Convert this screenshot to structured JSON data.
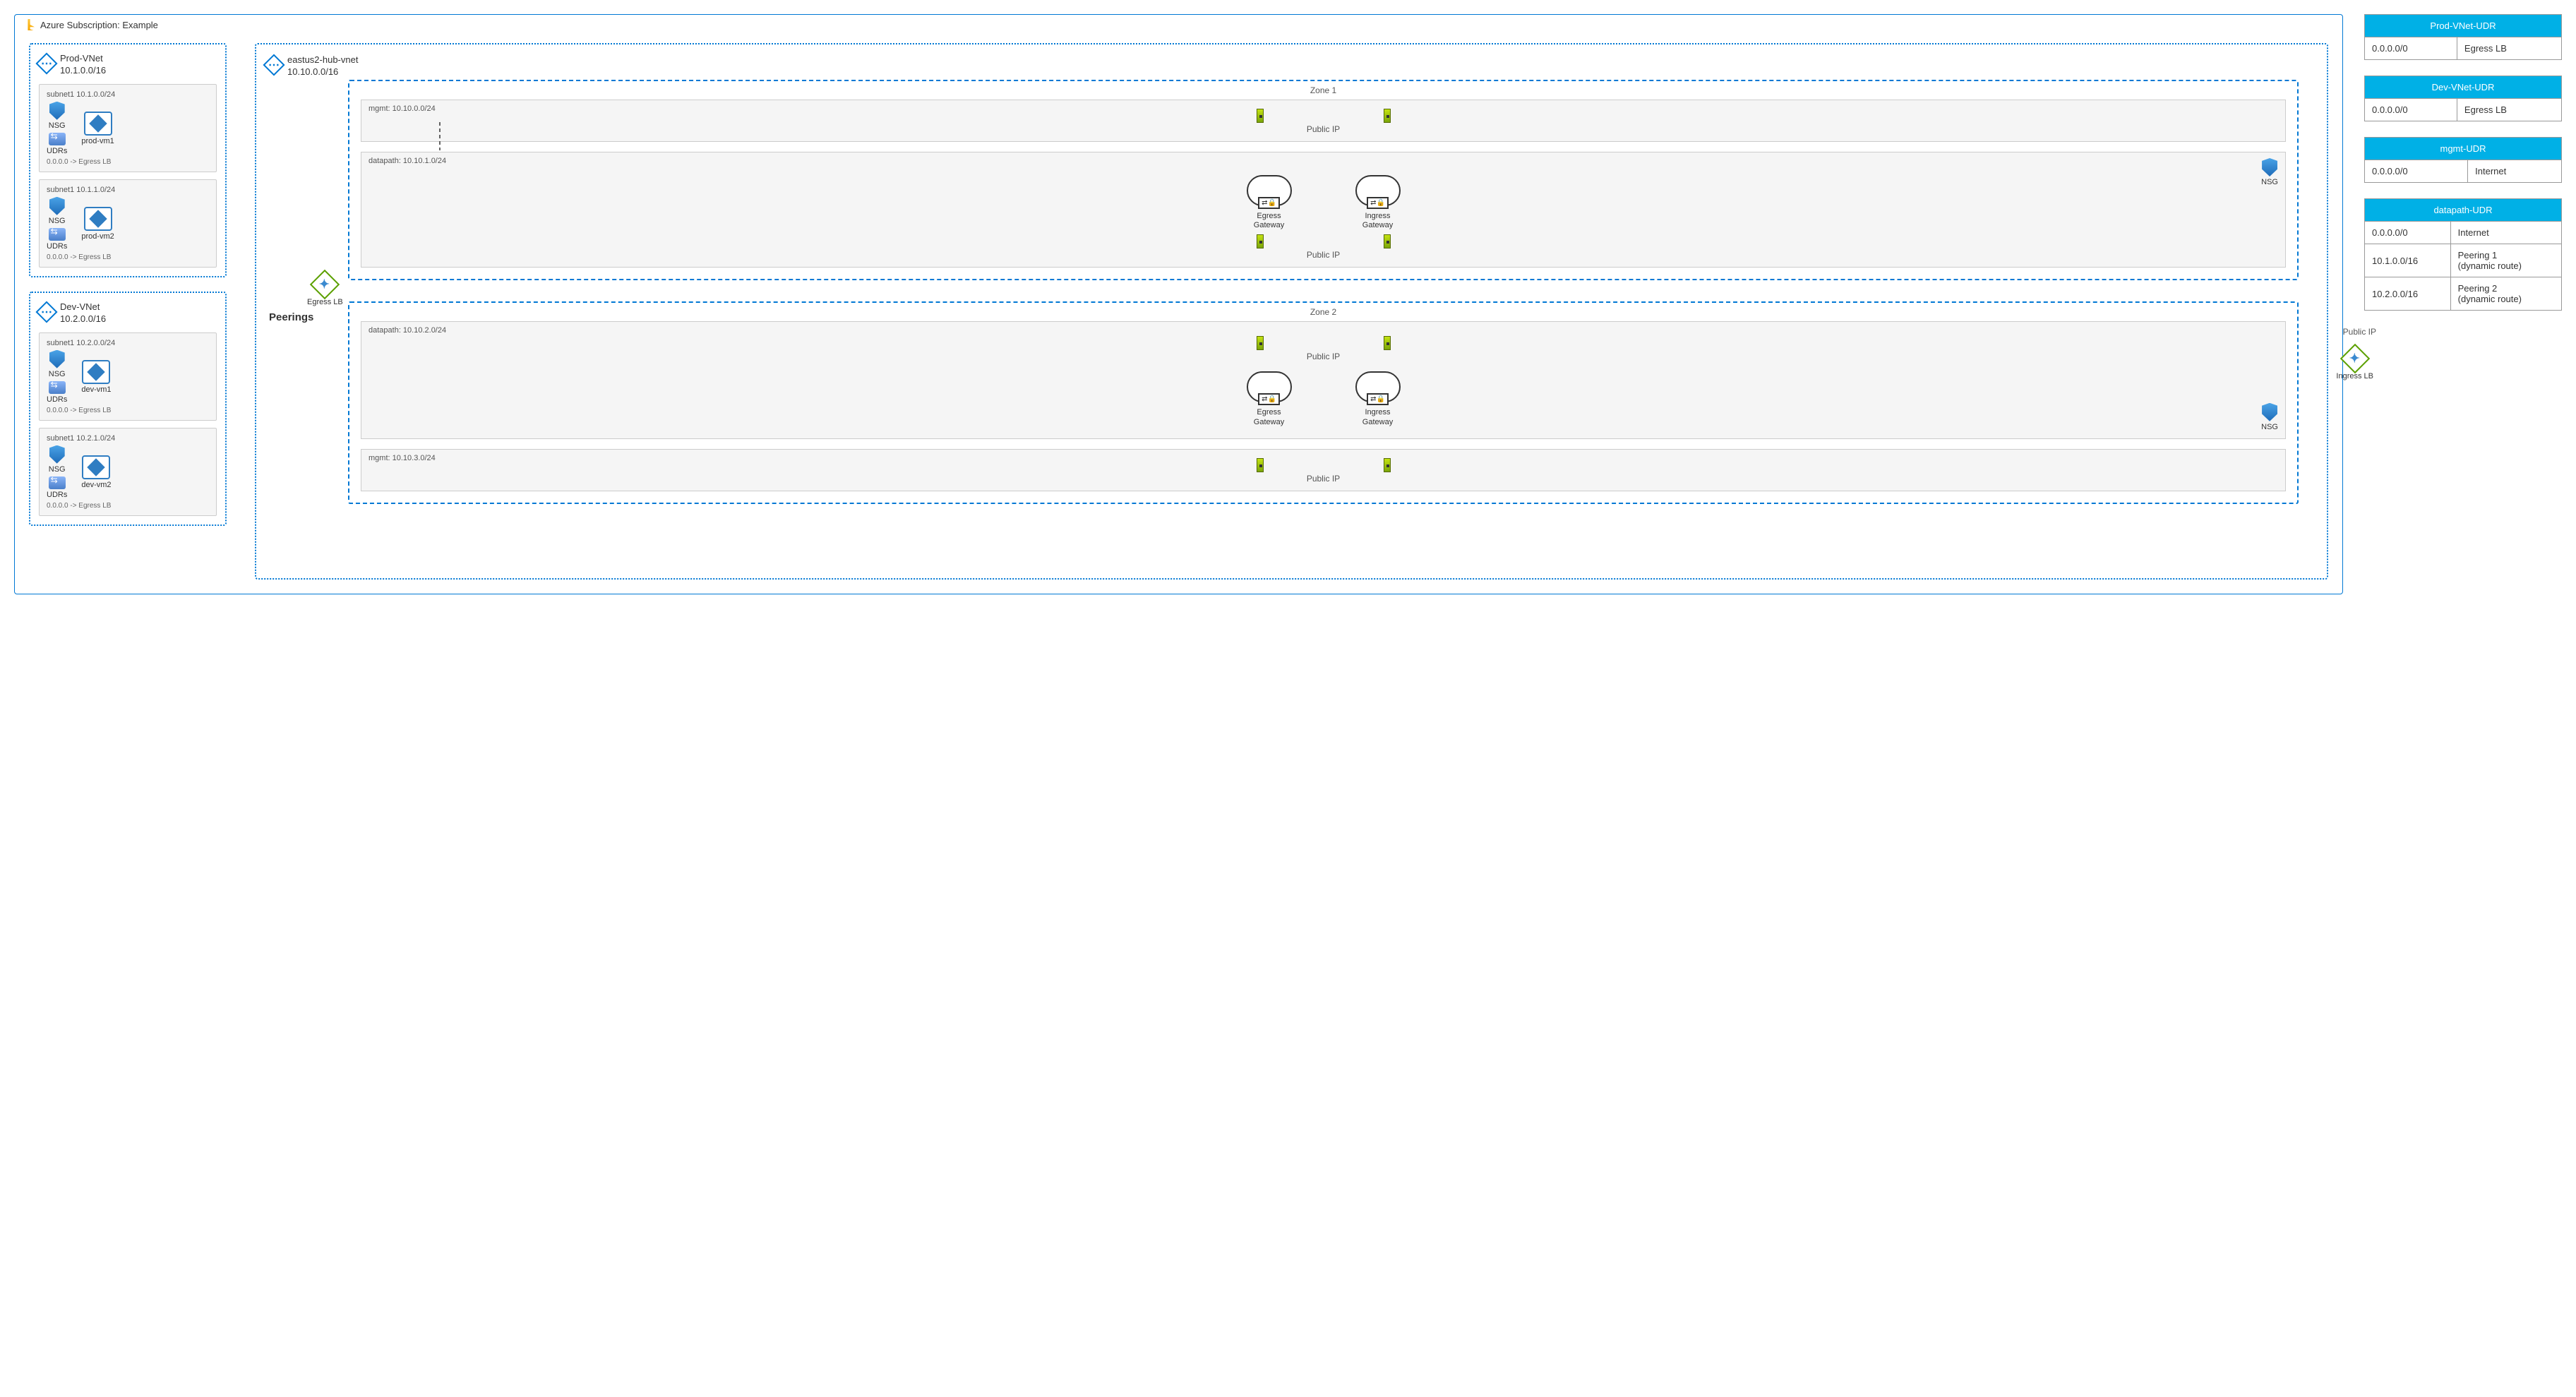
{
  "subscription": {
    "title": "Azure Subscription: Example"
  },
  "peerings_label": "Peerings",
  "prod_vnet": {
    "name": "Prod-VNet",
    "cidr": "10.1.0.0/16",
    "subnets": [
      {
        "label": "subnet1  10.1.0.0/24",
        "vm": "prod-vm1",
        "udr_note": "0.0.0.0 -> Egress LB",
        "nsg": "NSG",
        "udrs": "UDRs"
      },
      {
        "label": "subnet1  10.1.1.0/24",
        "vm": "prod-vm2",
        "udr_note": "0.0.0.0 -> Egress LB",
        "nsg": "NSG",
        "udrs": "UDRs"
      }
    ]
  },
  "dev_vnet": {
    "name": "Dev-VNet",
    "cidr": "10.2.0.0/16",
    "subnets": [
      {
        "label": "subnet1  10.2.0.0/24",
        "vm": "dev-vm1",
        "udr_note": "0.0.0.0 -> Egress LB",
        "nsg": "NSG",
        "udrs": "UDRs"
      },
      {
        "label": "subnet1  10.2.1.0/24",
        "vm": "dev-vm2",
        "udr_note": "0.0.0.0 -> Egress LB",
        "nsg": "NSG",
        "udrs": "UDRs"
      }
    ]
  },
  "hub_vnet": {
    "name": "eastus2-hub-vnet",
    "cidr": "10.10.0.0/16",
    "egress_lb": "Egress LB",
    "ingress_lb": "Ingress LB",
    "ingress_pip": "Public IP",
    "zones": [
      {
        "title": "Zone 1",
        "mgmt": {
          "label": "mgmt: 10.10.0.0/24",
          "pip": "Public IP"
        },
        "datapath": {
          "label": "datapath: 10.10.1.0/24",
          "pip": "Public IP",
          "nsg": "NSG",
          "egress": "Egress\nGateway",
          "ingress": "Ingress\nGateway"
        }
      },
      {
        "title": "Zone 2",
        "datapath": {
          "label": "datapath: 10.10.2.0/24",
          "pip": "Public IP",
          "nsg": "NSG",
          "egress": "Egress\nGateway",
          "ingress": "Ingress\nGateway"
        },
        "mgmt": {
          "label": "mgmt: 10.10.3.0/24",
          "pip": "Public IP"
        }
      }
    ]
  },
  "tables": {
    "prod": {
      "title": "Prod-VNet-UDR",
      "rows": [
        {
          "dest": "0.0.0.0/0",
          "hop": "Egress LB"
        }
      ]
    },
    "dev": {
      "title": "Dev-VNet-UDR",
      "rows": [
        {
          "dest": "0.0.0.0/0",
          "hop": "Egress LB"
        }
      ]
    },
    "mgmt": {
      "title": "mgmt-UDR",
      "rows": [
        {
          "dest": "0.0.0.0/0",
          "hop": "Internet"
        }
      ]
    },
    "datapath": {
      "title": "datapath-UDR",
      "rows": [
        {
          "dest": "0.0.0.0/0",
          "hop": "Internet"
        },
        {
          "dest": "10.1.0.0/16",
          "hop": "Peering 1\n(dynamic route)"
        },
        {
          "dest": "10.2.0.0/16",
          "hop": "Peering 2\n(dynamic route)"
        }
      ]
    }
  }
}
